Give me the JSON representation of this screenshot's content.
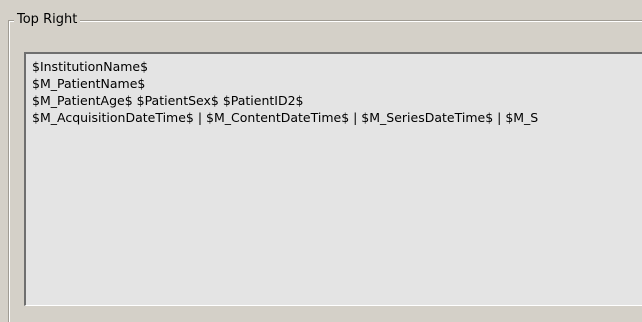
{
  "group": {
    "title": "Top Right"
  },
  "template_text": {
    "lines": [
      "$InstitutionName$",
      "$M_PatientName$",
      "$M_PatientAge$ $PatientSex$ $PatientID2$",
      "$M_AcquisitionDateTime$ | $M_ContentDateTime$ | $M_SeriesDateTime$ | $M_S"
    ]
  }
}
